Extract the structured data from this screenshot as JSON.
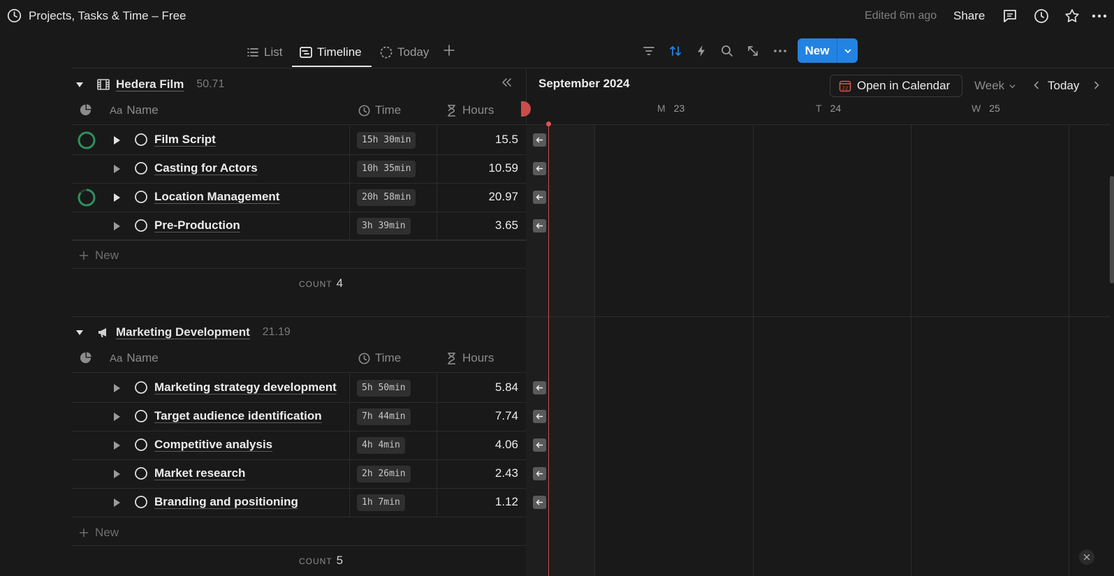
{
  "topbar": {
    "title": "Projects, Tasks & Time – Free",
    "edited": "Edited 6m ago",
    "share": "Share"
  },
  "views": {
    "tabs": [
      {
        "label": "List"
      },
      {
        "label": "Timeline"
      },
      {
        "label": "Today"
      }
    ],
    "active": "Timeline",
    "new_label": "New"
  },
  "columns": {
    "name": "Name",
    "time": "Time",
    "hours": "Hours",
    "name_prefix": "Aa"
  },
  "groups": [
    {
      "name": "Hedera Film",
      "total": "50.71",
      "rows": [
        {
          "name": "Film Script",
          "time": "15h 30min",
          "hours": "15.5",
          "progress": 1.0
        },
        {
          "name": "Casting for Actors",
          "time": "10h 35min",
          "hours": "10.59",
          "progress": 0
        },
        {
          "name": "Location Management",
          "time": "20h 58min",
          "hours": "20.97",
          "progress": 0.85
        },
        {
          "name": "Pre-Production",
          "time": "3h 39min",
          "hours": "3.65",
          "progress": 0
        }
      ],
      "new_label": "New",
      "count_label": "COUNT",
      "count": "4"
    },
    {
      "name": "Marketing Development",
      "total": "21.19",
      "rows": [
        {
          "name": "Marketing strategy development",
          "time": "5h 50min",
          "hours": "5.84",
          "progress": 0
        },
        {
          "name": "Target audience identification",
          "time": "7h 44min",
          "hours": "7.74",
          "progress": 0
        },
        {
          "name": "Competitive analysis",
          "time": "4h 4min",
          "hours": "4.06",
          "progress": 0
        },
        {
          "name": "Market research",
          "time": "2h 26min",
          "hours": "2.43",
          "progress": 0
        },
        {
          "name": "Branding and positioning",
          "time": "1h 7min",
          "hours": "1.12",
          "progress": 0
        }
      ],
      "new_label": "New",
      "count_label": "COUNT",
      "count": "5"
    }
  ],
  "calendar": {
    "month": "September 2024",
    "open_label": "Open in Calendar",
    "calendar_badge": "22",
    "range": "Week",
    "today": "Today",
    "days": [
      {
        "letter": "M",
        "num": "23"
      },
      {
        "letter": "T",
        "num": "24"
      },
      {
        "letter": "W",
        "num": "25"
      }
    ]
  },
  "colors": {
    "accent": "#2383e2",
    "progress": "#2f8f5b",
    "today_line": "#cc4b4b"
  }
}
